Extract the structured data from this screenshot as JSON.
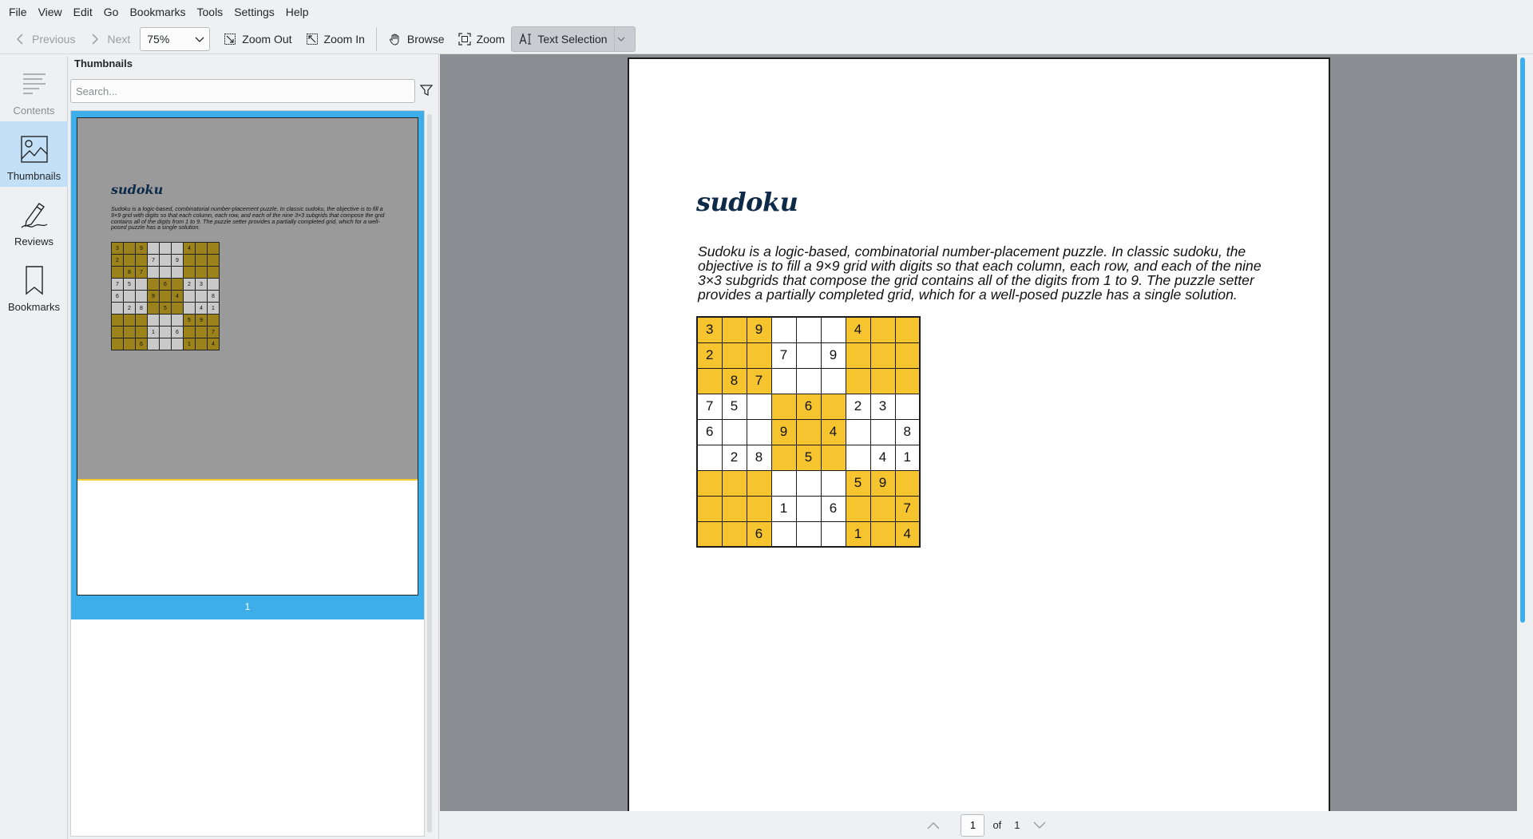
{
  "menubar": {
    "items": [
      "File",
      "View",
      "Edit",
      "Go",
      "Bookmarks",
      "Tools",
      "Settings",
      "Help"
    ]
  },
  "toolbar": {
    "previous_label": "Previous",
    "next_label": "Next",
    "zoom_value": "75%",
    "zoom_out_label": "Zoom Out",
    "zoom_in_label": "Zoom In",
    "browse_label": "Browse",
    "zoom_tool_label": "Zoom",
    "text_selection_label": "Text Selection"
  },
  "sidebar": {
    "tabs": [
      {
        "label": "Contents",
        "icon": "contents-icon",
        "state": "disabled"
      },
      {
        "label": "Thumbnails",
        "icon": "image-icon",
        "state": "selected"
      },
      {
        "label": "Reviews",
        "icon": "pen-icon",
        "state": "normal"
      },
      {
        "label": "Bookmarks",
        "icon": "bookmark-icon",
        "state": "normal"
      }
    ]
  },
  "thumbnails": {
    "title": "Thumbnails",
    "search_placeholder": "Search...",
    "page_number": "1"
  },
  "document": {
    "title": "sudoku",
    "intro": "Sudoku is a logic-based, combinatorial number-placement puzzle. In classic sudoku, the objective is to fill a 9×9 grid with digits so that each column, each row, and each of the nine 3×3 subgrids that compose the grid contains all of the digits from 1 to 9. The puzzle setter provides a partially completed grid, which for a well-posed puzzle has a single solution.",
    "highlight_color": "#f6c42e",
    "grid": [
      [
        "3",
        "",
        "9",
        "",
        "",
        "",
        "4",
        "",
        ""
      ],
      [
        "2",
        "",
        "",
        "7",
        "",
        "9",
        "",
        "",
        ""
      ],
      [
        "",
        "8",
        "7",
        "",
        "",
        "",
        "",
        "",
        ""
      ],
      [
        "7",
        "5",
        "",
        "",
        "6",
        "",
        "2",
        "3",
        ""
      ],
      [
        "6",
        "",
        "",
        "9",
        "",
        "4",
        "",
        "",
        "8"
      ],
      [
        "",
        "2",
        "8",
        "",
        "5",
        "",
        "",
        "4",
        "1"
      ],
      [
        "",
        "",
        "",
        "",
        "",
        "",
        "5",
        "9",
        ""
      ],
      [
        "",
        "",
        "",
        "1",
        "",
        "6",
        "",
        "",
        "7"
      ],
      [
        "",
        "",
        "6",
        "",
        "",
        "",
        "1",
        "",
        "4"
      ]
    ]
  },
  "pagebar": {
    "current_page": "1",
    "of_label": "of",
    "total_pages": "1"
  },
  "colors": {
    "accent": "#3daee9",
    "title_color": "#0d2a48",
    "background_view": "#8a8d92"
  }
}
